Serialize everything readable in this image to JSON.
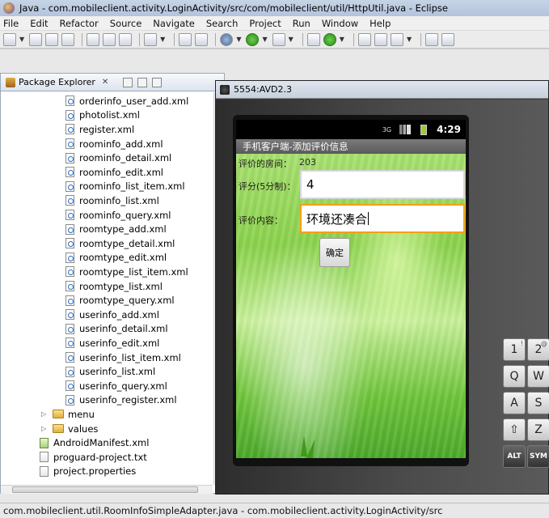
{
  "window": {
    "title": "Java - com.mobileclient.activity.LoginActivity/src/com/mobileclient/util/HttpUtil.java - Eclipse"
  },
  "menubar": {
    "items": [
      "File",
      "Edit",
      "Refactor",
      "Source",
      "Navigate",
      "Search",
      "Project",
      "Run",
      "Window",
      "Help"
    ]
  },
  "package_explorer": {
    "tab_label": "Package Explorer",
    "xml_files": [
      "orderinfo_user_add.xml",
      "photolist.xml",
      "register.xml",
      "roominfo_add.xml",
      "roominfo_detail.xml",
      "roominfo_edit.xml",
      "roominfo_list_item.xml",
      "roominfo_list.xml",
      "roominfo_query.xml",
      "roomtype_add.xml",
      "roomtype_detail.xml",
      "roomtype_edit.xml",
      "roomtype_list_item.xml",
      "roomtype_list.xml",
      "roomtype_query.xml",
      "userinfo_add.xml",
      "userinfo_detail.xml",
      "userinfo_edit.xml",
      "userinfo_list_item.xml",
      "userinfo_list.xml",
      "userinfo_query.xml",
      "userinfo_register.xml"
    ],
    "folders": [
      "menu",
      "values"
    ],
    "root_files": [
      "AndroidManifest.xml",
      "proguard-project.txt",
      "project.properties"
    ]
  },
  "emulator": {
    "title": "5554:AVD2.3",
    "status_time": "4:29",
    "status_network": "3G",
    "app_title": "手机客户端-添加评价信息",
    "room_label": "评价的房间：",
    "room_value": "203",
    "score_label": "评分(5分制)：",
    "score_value": "4",
    "content_label": "评价内容：",
    "content_value": "环境还凑合",
    "confirm_button": "确定"
  },
  "keyboard": {
    "keys": [
      {
        "label": "1",
        "sub": "!"
      },
      {
        "label": "2",
        "sub": "@"
      },
      {
        "label": "Q",
        "sub": ""
      },
      {
        "label": "W",
        "sub": ""
      },
      {
        "label": "A",
        "sub": ""
      },
      {
        "label": "S",
        "sub": ""
      },
      {
        "label": "⇧",
        "sub": ""
      },
      {
        "label": "Z",
        "sub": ""
      },
      {
        "label": "ALT",
        "sub": ""
      },
      {
        "label": "SYM",
        "sub": ""
      }
    ]
  },
  "statusline": {
    "text": "com.mobileclient.util.RoomInfoSimpleAdapter.java - com.mobileclient.activity.LoginActivity/src"
  }
}
